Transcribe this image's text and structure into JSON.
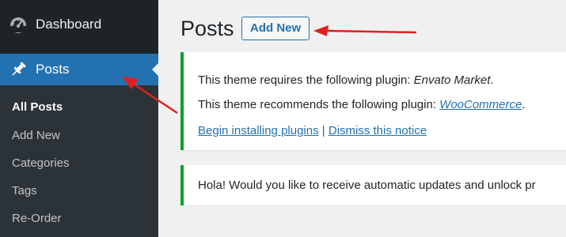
{
  "sidebar": {
    "dashboard": {
      "label": "Dashboard",
      "icon": "dashboard-icon"
    },
    "posts": {
      "label": "Posts",
      "icon": "pin-icon"
    },
    "submenu": [
      {
        "label": "All Posts",
        "current": true
      },
      {
        "label": "Add New"
      },
      {
        "label": "Categories"
      },
      {
        "label": "Tags"
      },
      {
        "label": "Re-Order"
      }
    ]
  },
  "main": {
    "title": "Posts",
    "add_new_label": "Add New",
    "notice1": {
      "requires_prefix": "This theme requires the following plugin: ",
      "requires_plugin": "Envato Market",
      "requires_suffix": ".",
      "recommends_prefix": "This theme recommends the following plugin: ",
      "recommends_plugin": "WooCommerce",
      "recommends_suffix": ".",
      "begin_link": "Begin installing plugins",
      "separator": "|",
      "dismiss_link": "Dismiss this notice"
    },
    "notice2": {
      "text": "Hola! Would you like to receive automatic updates and unlock pr"
    }
  },
  "annotations": {
    "arrow_color": "#e02020"
  },
  "colors": {
    "sidebar_bg": "#1d2327",
    "submenu_bg": "#2c3338",
    "accent": "#2271b1",
    "notice_border": "#00a32a"
  }
}
